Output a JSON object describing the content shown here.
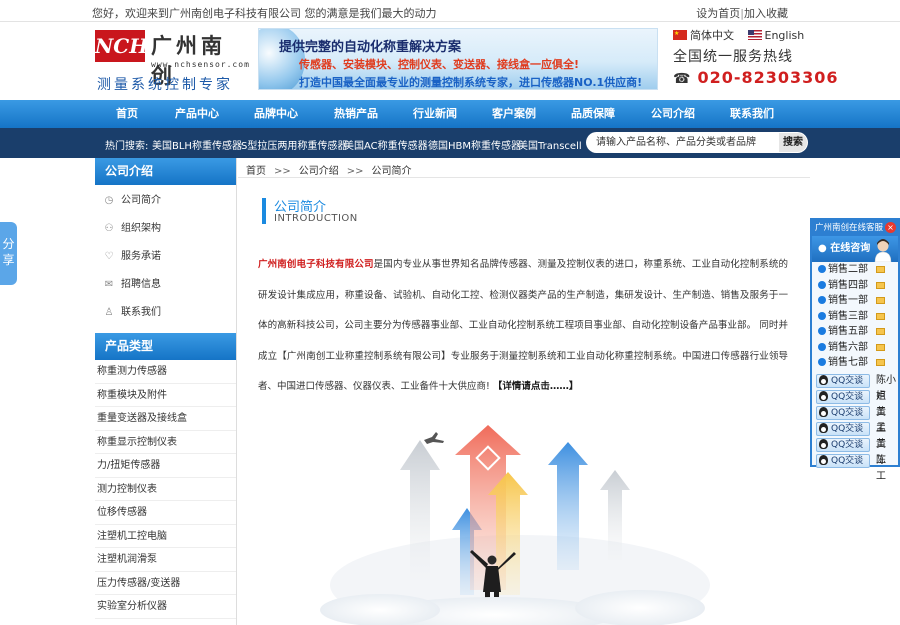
{
  "topbar": {
    "welcome": "您好，欢迎来到广州南创电子科技有限公司 您的满意是我们最大的动力",
    "set_home": "设为首页",
    "separator": "|",
    "bookmark": "加入收藏"
  },
  "logo": {
    "abbr": "NCH",
    "name": "广州南创",
    "url": "www.nchsensor.com",
    "slogan": "测量系统控制专家"
  },
  "banner": {
    "line1": "提供完整的自动化称重解决方案",
    "line2": "传感器、安装模块、控制仪表、变送器、接线盒一应俱全!",
    "line3": "打造中国最全面最专业的测量控制系统专家，进口传感器NO.1供应商!"
  },
  "lang": {
    "cn": "简体中文",
    "en": "English"
  },
  "hotline": {
    "label": "全国统一服务热线",
    "number": "020-82303306"
  },
  "nav": [
    "首页",
    "产品中心",
    "品牌中心",
    "热销产品",
    "行业新闻",
    "客户案例",
    "品质保障",
    "公司介绍",
    "联系我们"
  ],
  "subnav": {
    "hot_label": "热门搜索:",
    "keywords": [
      "美国BLH称重传感器",
      "S型拉压两用称重传感器",
      "美国AC称重传感器",
      "德国HBM称重传感器",
      "美国Transcell"
    ],
    "search_placeholder": "请输入产品名称、产品分类或者品牌",
    "search_button": "搜索"
  },
  "share": "分享",
  "sidebar": {
    "about_title": "公司介绍",
    "about_items": [
      {
        "label": "公司简介",
        "icon": "clock-icon"
      },
      {
        "label": "组织架构",
        "icon": "org-icon"
      },
      {
        "label": "服务承诺",
        "icon": "heart-icon"
      },
      {
        "label": "招聘信息",
        "icon": "mail-icon"
      },
      {
        "label": "联系我们",
        "icon": "user-icon"
      }
    ],
    "product_title": "产品类型",
    "product_items": [
      "称重测力传感器",
      "称重模块及附件",
      "重量变送器及接线盒",
      "称重显示控制仪表",
      "力/扭矩传感器",
      "测力控制仪表",
      "位移传感器",
      "注塑机工控电脑",
      "注塑机润滑泵",
      "压力传感器/变送器",
      "实验室分析仪器"
    ]
  },
  "breadcrumb": {
    "home": "首页",
    "sep": ">>",
    "level1": "公司介绍",
    "level2": "公司简介"
  },
  "section": {
    "title_cn": "公司简介",
    "title_en": "INTRODUCTION"
  },
  "intro": {
    "company": "广州南创电子科技有限公司",
    "body": "是国内专业从事世界知名品牌传感器、测量及控制仪表的进口，称重系统、工业自动化控制系统的研发设计集成应用，称重设备、试验机、自动化工控、检测仪器类产品的生产制造，集研发设计、生产制造、销售及服务于一体的高新科技公司，公司主要分为传感器事业部、工业自动化控制系统工程项目事业部、自动化控制设备产品事业部。 同时并成立【广州南创工业称重控制系统有限公司】专业服务于测量控制系统和工业自动化称重控制系统。中国进口传感器行业领导者、中国进口传感器、仪器仪表、工业备件十大供应商!",
    "more": "【详情请点击……】"
  },
  "service": {
    "title": "广州南创在线客服",
    "online": "在线咨询",
    "sales": [
      "销售二部",
      "销售四部",
      "销售一部",
      "销售三部",
      "销售五部",
      "销售六部",
      "销售七部"
    ],
    "qq_label": "QQ交谈",
    "qq_names": [
      "陈小姐",
      "卢　工",
      "黄　工",
      "孟　工",
      "黄　工",
      "陈　工"
    ]
  },
  "colors": {
    "nav_blue": "#1574c6",
    "subnav_navy": "#1a3e6b",
    "accent_red": "#d01f1f",
    "title_blue": "#1b8ae0"
  }
}
